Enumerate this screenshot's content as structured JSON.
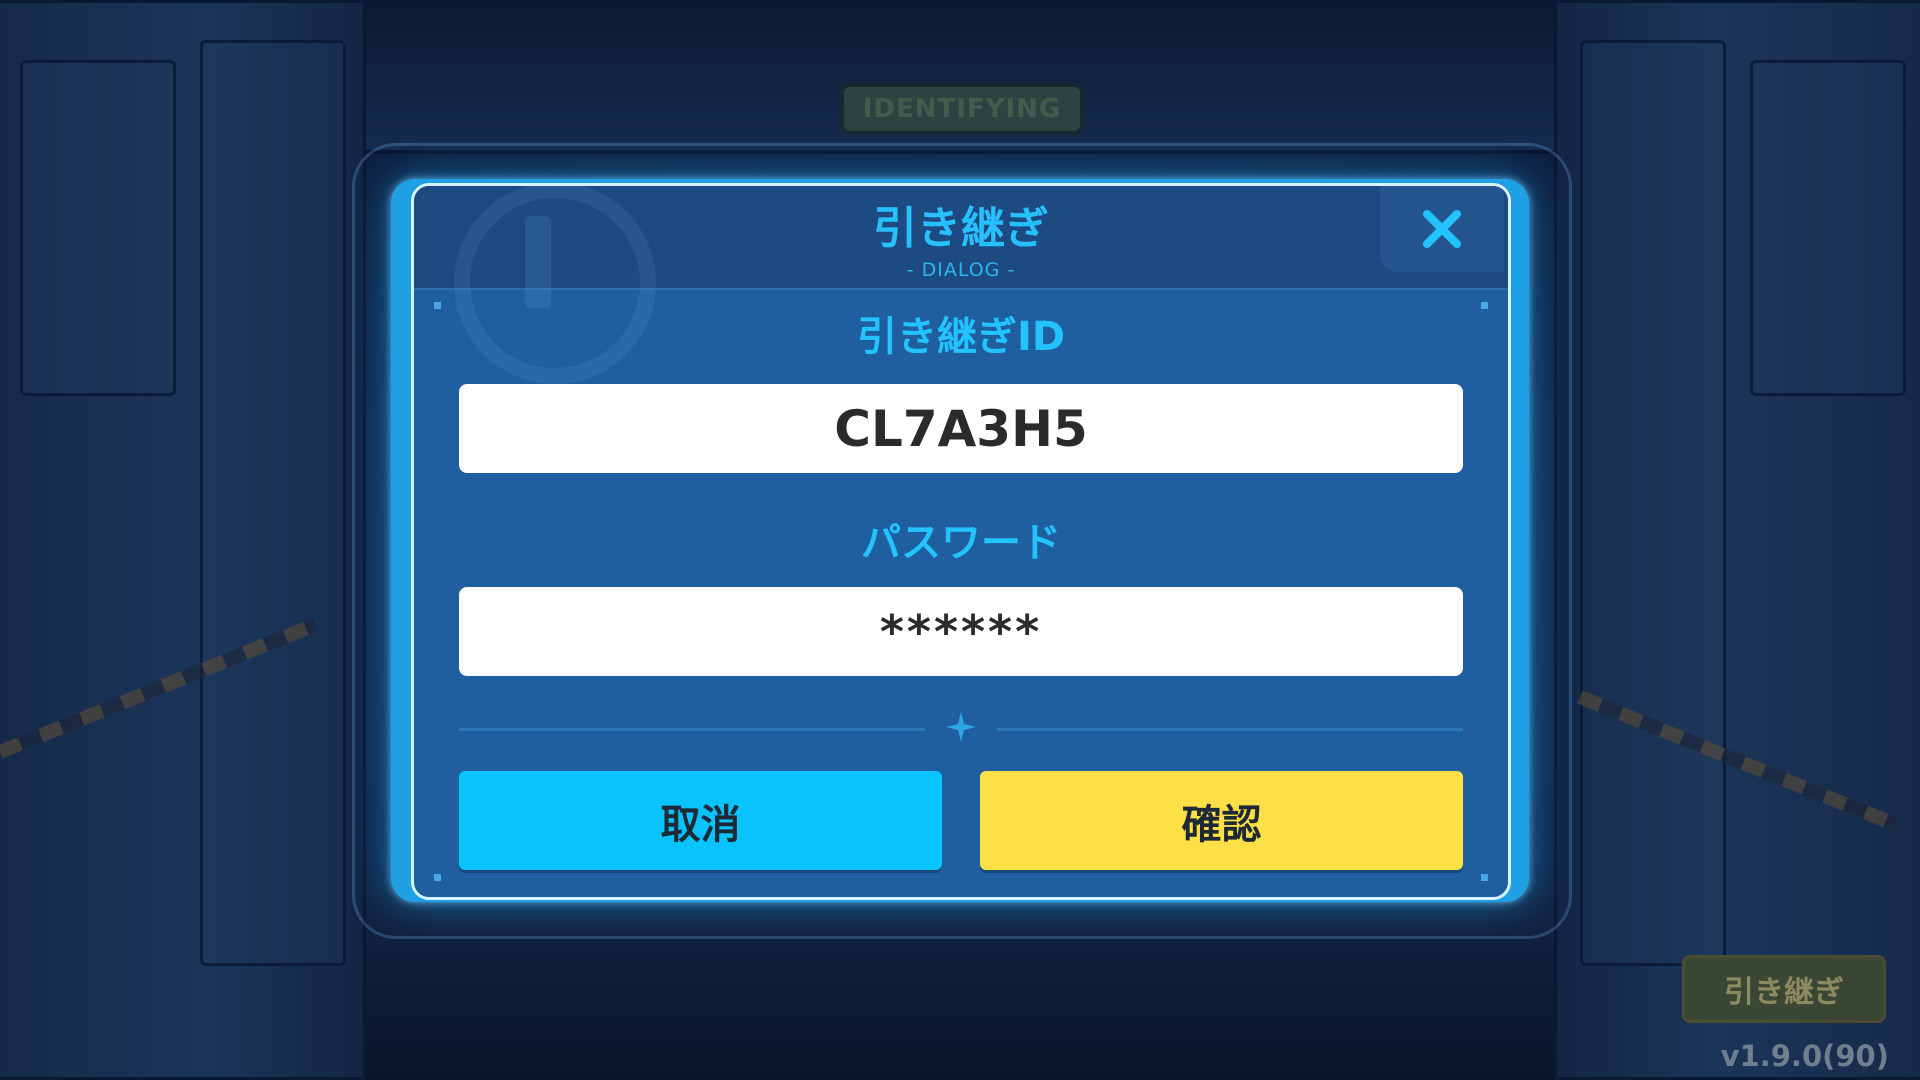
{
  "background": {
    "sign_text": "IDENTIFYING"
  },
  "dialog": {
    "title": "引き継ぎ",
    "subtitle": "- DIALOG -",
    "close_icon": "close-x-icon",
    "id_label": "引き継ぎID",
    "id_value": "CL7A3H5",
    "password_label": "パスワード",
    "password_value": "******",
    "cancel_label": "取消",
    "confirm_label": "確認",
    "divider_icon": "four-point-star-icon"
  },
  "corner": {
    "transfer_button_label": "引き継ぎ",
    "version": "v1.9.0(90)"
  },
  "colors": {
    "accent_blue": "#22c3ff",
    "cancel_button": "#09c3ff",
    "confirm_button": "#fddf46",
    "dialog_body": "#1f5fa0",
    "dialog_frame": "#1f9fe4"
  }
}
